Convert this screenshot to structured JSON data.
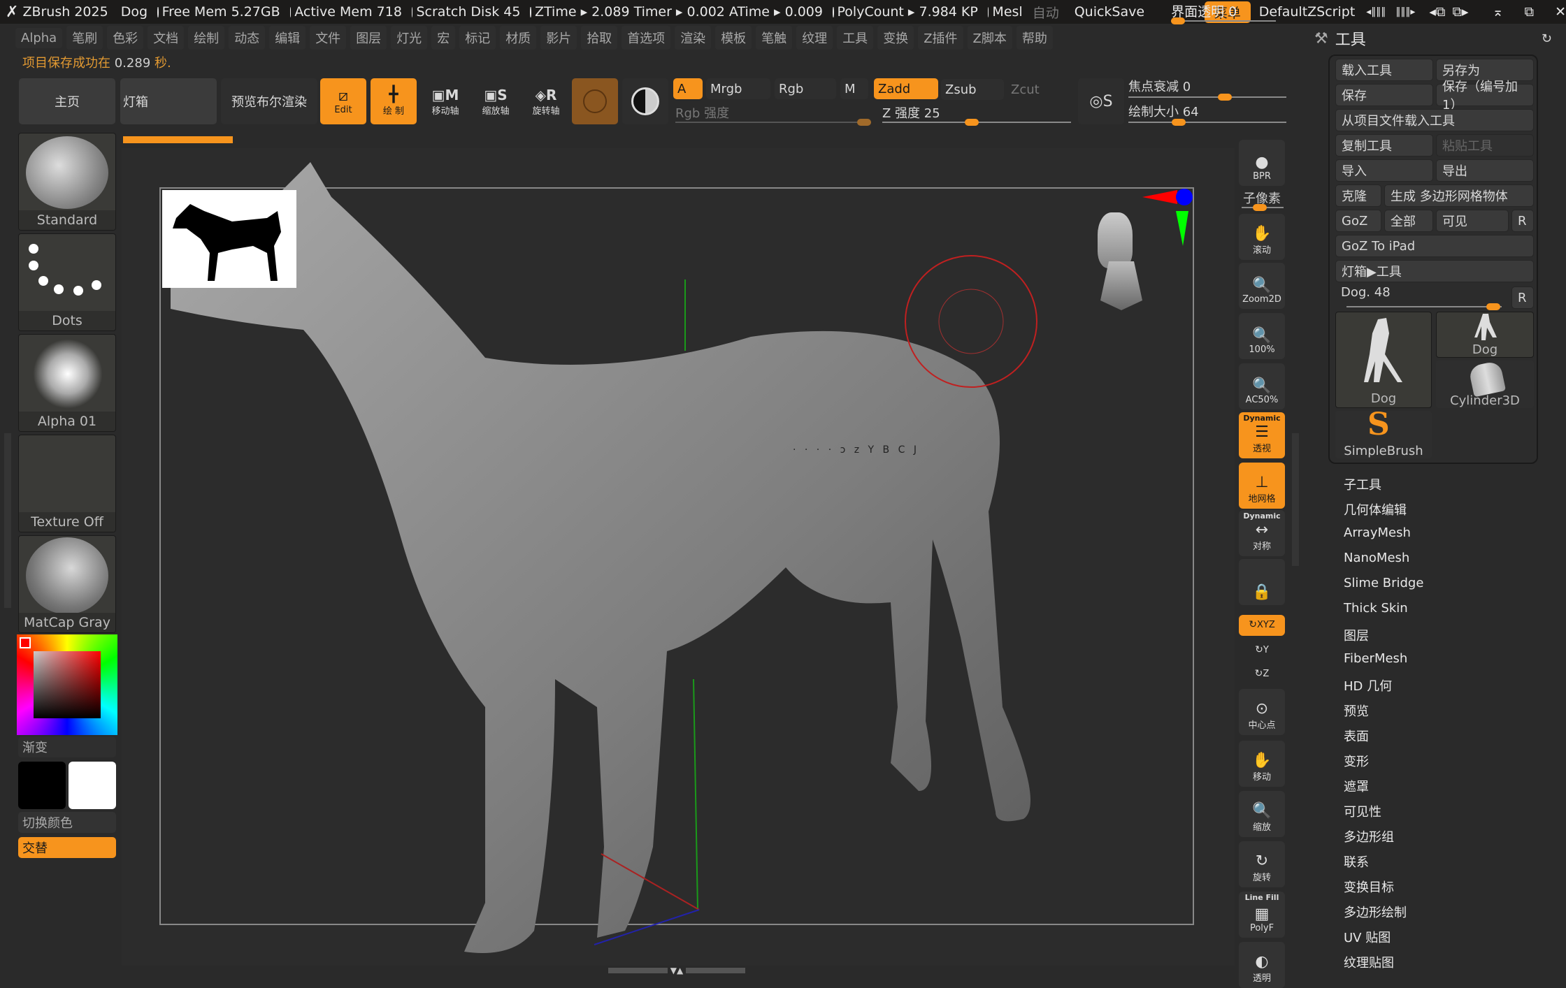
{
  "titlebar": {
    "app": "ZBrush 2025",
    "doc": "Dog",
    "free_mem": "Free Mem 5.27GB",
    "active_mem": "Active Mem 718",
    "scratch_disk": "Scratch Disk 45",
    "ztime": "ZTime ▸ 2.089 Timer ▸ 0.002 ATime ▸ 0.009",
    "polycount": "PolyCount ▸ 7.984 KP",
    "mesh": "Mesl",
    "auto": "自动",
    "quicksave": "QuickSave",
    "ui_transparency": "界面透明 0",
    "ui_transparency_value": 0,
    "menu_button": "菜单",
    "script": "DefaultZScript"
  },
  "menubar": [
    "Alpha",
    "笔刷",
    "色彩",
    "文档",
    "绘制",
    "动态",
    "编辑",
    "文件",
    "图层",
    "灯光",
    "宏",
    "标记",
    "材质",
    "影片",
    "拾取",
    "首选项",
    "渲染",
    "模板",
    "笔触",
    "纹理",
    "工具",
    "变换",
    "Z插件",
    "Z脚本",
    "帮助"
  ],
  "status": {
    "prefix": "项目保存成功在",
    "value": "0.289",
    "suffix": "秒."
  },
  "toolbar": {
    "home": "主页",
    "lightbox": "灯箱",
    "bpr_preview": "预览布尔渲染",
    "edit": "Edit",
    "draw": "绘 制",
    "move": "移动轴",
    "scale": "缩放轴",
    "rotate": "旋转轴",
    "a": "A",
    "mrgb": "Mrgb",
    "rgb": "Rgb",
    "m": "M",
    "zadd": "Zadd",
    "zsub": "Zsub",
    "zcut": "Zcut",
    "rgb_intensity": "Rgb 强度",
    "z_intensity": "Z 强度 25",
    "z_intensity_value": 25,
    "focal_shift": "焦点衰减 0",
    "focal_shift_value": 0,
    "draw_size": "绘制大小 64",
    "draw_size_value": 64
  },
  "left_panel": {
    "brush": "Standard",
    "stroke": "Dots",
    "alpha": "Alpha 01",
    "texture": "Texture Off",
    "material": "MatCap Gray",
    "gradient": "渐变",
    "switch_color": "切换颜色",
    "alternate": "交替",
    "main_color": "#ff0000",
    "secondary_color_a": "#000000",
    "secondary_color_b": "#ffffff"
  },
  "right_toolbar": [
    {
      "id": "bpr",
      "label": "BPR"
    },
    {
      "id": "subpixel",
      "label": "子像素"
    },
    {
      "id": "scroll",
      "label": "滚动"
    },
    {
      "id": "zoom2d",
      "label": "Zoom2D"
    },
    {
      "id": "actual",
      "label": "100%"
    },
    {
      "id": "ac50",
      "label": "AC50%"
    },
    {
      "id": "persp",
      "label": "透视",
      "top": "Dynamic"
    },
    {
      "id": "floor",
      "label": "地网格"
    },
    {
      "id": "sym",
      "label": "对称",
      "top": "Dynamic"
    },
    {
      "id": "lock",
      "label": ""
    },
    {
      "id": "xyz",
      "label": "XYZ"
    },
    {
      "id": "y",
      "label": "Y"
    },
    {
      "id": "z",
      "label": "Z"
    },
    {
      "id": "center",
      "label": "中心点"
    },
    {
      "id": "move",
      "label": "移动"
    },
    {
      "id": "zoom",
      "label": "缩放"
    },
    {
      "id": "rotate",
      "label": "旋转"
    },
    {
      "id": "polyf",
      "label": "PolyF",
      "top": "Line Fill"
    },
    {
      "id": "transp",
      "label": "透明"
    }
  ],
  "tool_panel": {
    "title": "工具",
    "load_tool": "载入工具",
    "save_as": "另存为",
    "save": "保存",
    "save_inc": "保存（编号加 1）",
    "load_from_project": "从项目文件载入工具",
    "copy_tool": "复制工具",
    "paste_tool": "粘贴工具",
    "import": "导入",
    "export": "导出",
    "clone": "克隆",
    "make_polymesh": "生成 多边形网格物体",
    "goz": "GoZ",
    "all": "全部",
    "visible": "可见",
    "r": "R",
    "goz_ipad": "GoZ To iPad",
    "lightbox_tools": "灯箱▶工具",
    "current_tool": "Dog. 48",
    "current_tool_value": 48,
    "thumbs": [
      "Dog",
      "Dog",
      "Cylinder3D",
      "SimpleBrush"
    ],
    "subpalettes": [
      "子工具",
      "几何体编辑",
      "ArrayMesh",
      "NanoMesh",
      "Slime Bridge",
      "Thick Skin",
      "图层",
      "FiberMesh",
      "HD 几何",
      "预览",
      "表面",
      "变形",
      "遮罩",
      "可见性",
      "多边形组",
      "联系",
      "变换目标",
      "多边形绘制",
      "UV 贴图",
      "纹理贴图"
    ]
  },
  "viewport": {
    "overlay_text": "· · · · ɔ z Y B C J"
  }
}
